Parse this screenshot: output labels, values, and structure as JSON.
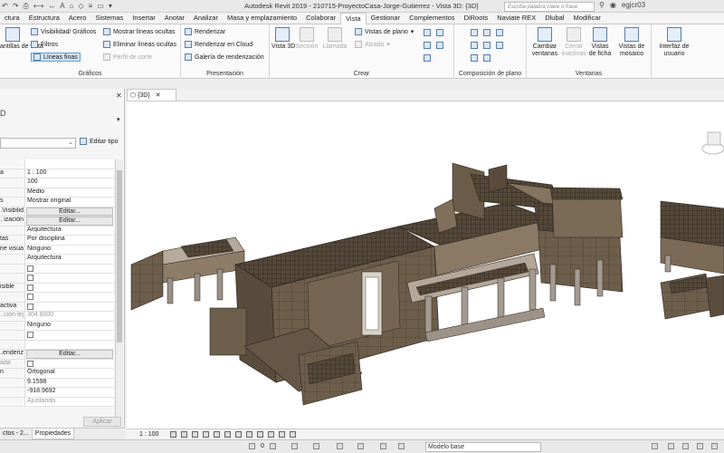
{
  "window": {
    "title": "Autodesk Revit 2019 - 210715-ProyectoCasa-Jorge-Gutierrez - Vista 3D: {3D}",
    "search_placeholder": "Escriba palabra clave o frase",
    "user": "egjcr03"
  },
  "tabs": [
    {
      "label": "ctura"
    },
    {
      "label": "Estructura"
    },
    {
      "label": "Acero"
    },
    {
      "label": "Sistemas"
    },
    {
      "label": "Insertar"
    },
    {
      "label": "Anotar"
    },
    {
      "label": "Analizar"
    },
    {
      "label": "Masa y emplazamiento"
    },
    {
      "label": "Colaborar"
    },
    {
      "label": "Vista"
    },
    {
      "label": "Gestionar"
    },
    {
      "label": "Complementos"
    },
    {
      "label": "DiRoots"
    },
    {
      "label": "Naviate REX"
    },
    {
      "label": "Dlubal"
    },
    {
      "label": "Modificar"
    }
  ],
  "ribbon": {
    "graficos": {
      "label": "Gráficos",
      "plantillas": "antillas de vista",
      "visibilidad": "Visibilidad/ Gráficos",
      "filtros": "Filtros",
      "lineas_finas": "Líneas finas",
      "mostrar_ocultas": "Mostrar líneas ocultas",
      "eliminar_ocultas": "Eliminar líneas ocultas",
      "perfil_corte": "Perfil de corte"
    },
    "presentacion": {
      "label": "Presentación",
      "renderizar": "Renderizar",
      "renderizar_nube": "Renderizar  en Cloud",
      "galeria": "Galería de  renderización"
    },
    "crear": {
      "label": "Crear",
      "vista3d": "Vista 3D",
      "seccion": "Sección",
      "llamada": "Llamada",
      "vistas_plano": "Vistas de plano",
      "alzado": "Alzado"
    },
    "composicion": {
      "label": "Composición de plano"
    },
    "ventanas": {
      "label": "Ventanas",
      "cambiar": "Cambiar ventanas",
      "cerrar": "Cerrar inactivas",
      "ficha": "Vistas de ficha",
      "mosaico": "Vistas de mosaico",
      "interfaz": "Interfaz de usuario"
    }
  },
  "properties": {
    "type_label": "D",
    "edit_type": "Editar tipo",
    "rows": [
      {
        "label": "",
        "value": ""
      },
      {
        "label": "a",
        "value": "1 : 100"
      },
      {
        "label": "",
        "value": "100"
      },
      {
        "label": "",
        "value": "Medio"
      },
      {
        "label": "s",
        "value": "Mostrar original"
      },
      {
        "label": "Visibilid...",
        "value": "Editar...",
        "button": true
      },
      {
        "label": "ización ...",
        "value": "Editar...",
        "button": true
      },
      {
        "label": "",
        "value": "Arquitectura"
      },
      {
        "label": "tas",
        "value": "Por disciplina"
      },
      {
        "label": "ne visua...",
        "value": "Ninguno"
      },
      {
        "label": "",
        "value": "Arquitectura"
      },
      {
        "label": "",
        "value": ""
      },
      {
        "label": "",
        "value": ""
      },
      {
        "label": "isible",
        "value": ""
      },
      {
        "label": "",
        "value": ""
      },
      {
        "label": "activa",
        "value": ""
      },
      {
        "label": "ción lej...",
        "value": "304.8000",
        "grey": true
      },
      {
        "label": "",
        "value": "Ninguno"
      },
      {
        "label": "",
        "value": ""
      },
      {
        "label": "",
        "value": ""
      },
      {
        "label": "enderiz...",
        "value": "Editar...",
        "button": true
      },
      {
        "label": "ada",
        "value": "",
        "grey": true
      },
      {
        "label": "n",
        "value": "Ortogonal"
      },
      {
        "label": "",
        "value": "9.1598"
      },
      {
        "label": "",
        "value": "-918.9692"
      },
      {
        "label": "",
        "value": "Ajustando",
        "grey": true
      }
    ],
    "apply": "Aplicar",
    "bottom_tabs": [
      "ctos - 2...",
      "Propiedades"
    ]
  },
  "view": {
    "tab_label": "{3D}",
    "scale": "1 : 100"
  },
  "status": {
    "model": "Modelo base",
    "zero": "0"
  },
  "colors": {
    "wall": "#6e5f4d",
    "wall_dark": "#4f4234",
    "wall_light": "#8b7a64",
    "slab": "#b9b0a3",
    "roof": "#55493c"
  }
}
